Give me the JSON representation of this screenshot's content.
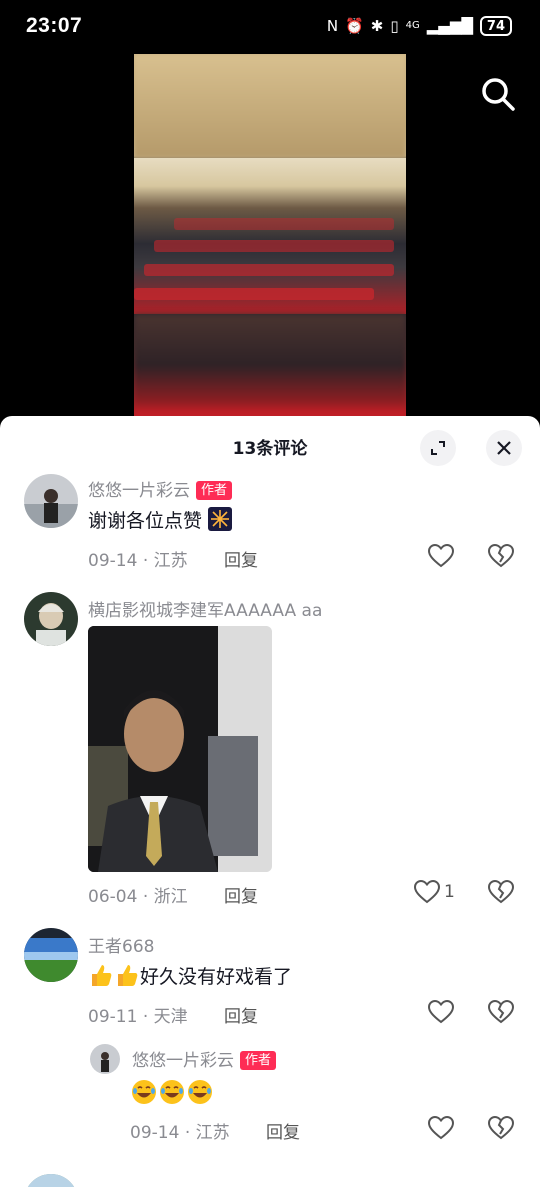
{
  "status": {
    "time": "23:07",
    "battery": "74",
    "network": "4G"
  },
  "sheet": {
    "title": "13条评论"
  },
  "comments": [
    {
      "username": "悠悠一片彩云",
      "badge": "作者",
      "text": "谢谢各位点赞",
      "date": "09-14",
      "location": "江苏",
      "reply_label": "回复"
    },
    {
      "username": "横店影视城李建军AAAAAA aa",
      "date": "06-04",
      "location": "浙江",
      "reply_label": "回复",
      "likes": "1"
    },
    {
      "username": "王者668",
      "text": "好久没有好戏看了",
      "date": "09-11",
      "location": "天津",
      "reply_label": "回复"
    },
    {
      "username": "悠悠一片彩云",
      "badge": "作者",
      "date": "09-14",
      "location": "江苏",
      "reply_label": "回复"
    }
  ],
  "separator": "·",
  "colors": {
    "accent": "#fe2c55",
    "text": "#161823",
    "muted": "#8a8b91"
  },
  "icons": [
    "search-icon",
    "expand-icon",
    "close-icon",
    "heart-icon",
    "dislike-heart-icon",
    "thumbs-up-emoji",
    "laughing-emoji",
    "fireworks-emoji"
  ]
}
